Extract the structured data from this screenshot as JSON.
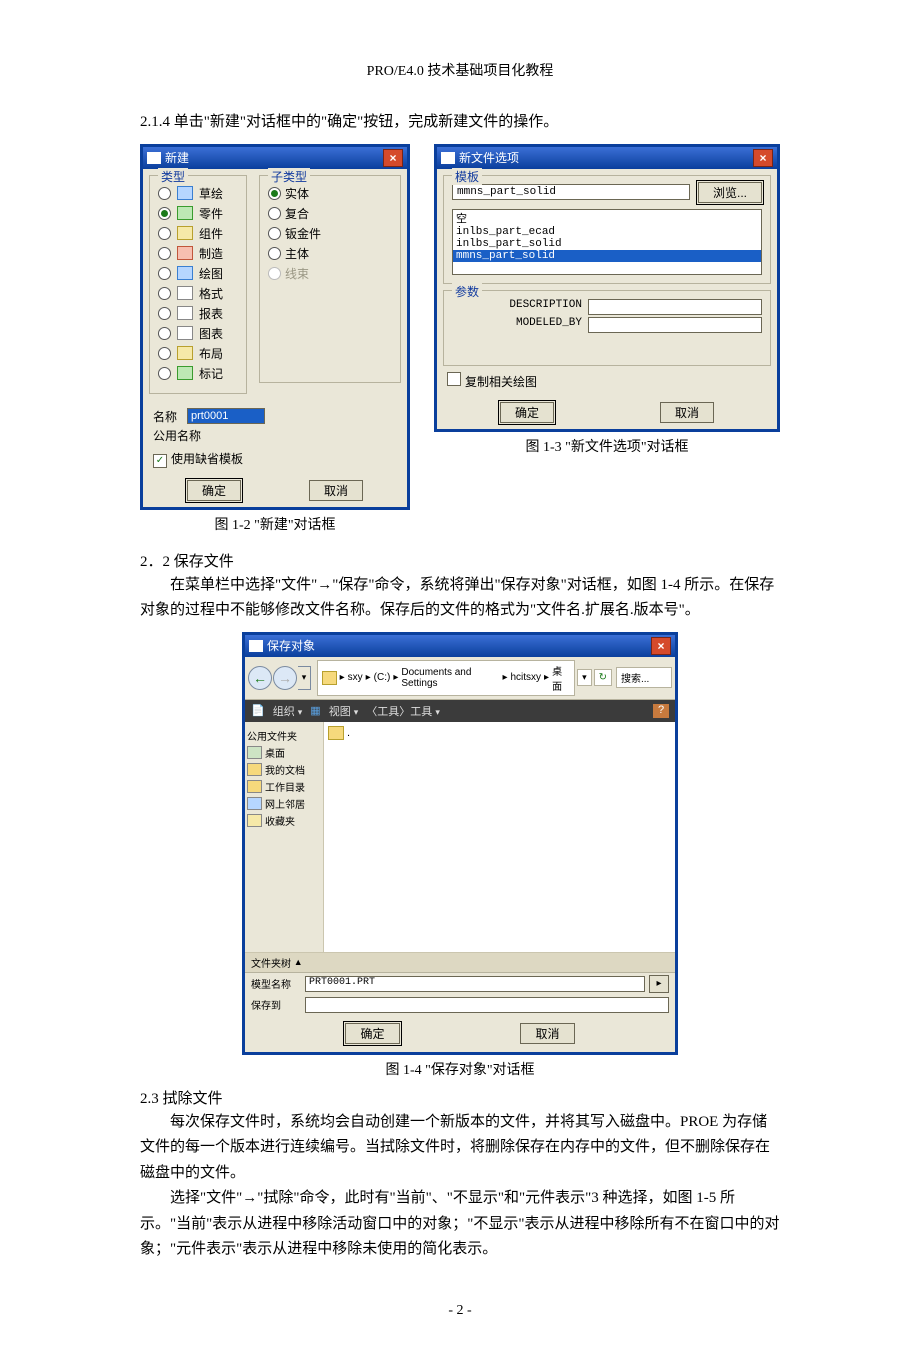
{
  "header": "PRO/E4.0 技术基础项目化教程",
  "text": {
    "step": "2.1.4 单击\"新建\"对话框中的\"确定\"按钮，完成新建文件的操作。",
    "cap12": "图 1-2  \"新建\"对话框",
    "cap13": "图 1-3  \"新文件选项\"对话框",
    "sec2": "2．2  保存文件",
    "p2a": "在菜单栏中选择\"文件\"→\"保存\"命令，系统将弹出\"保存对象\"对话框，如图 1-4 所示。在保存对象的过程中不能够修改文件名称。保存后的文件的格式为\"文件名.扩展名.版本号\"。",
    "cap14": "图 1-4  \"保存对象\"对话框",
    "sec3": "2.3  拭除文件",
    "p3a": "每次保存文件时，系统均会自动创建一个新版本的文件，并将其写入磁盘中。PROE 为存储文件的每一个版本进行连续编号。当拭除文件时，将删除保存在内存中的文件，但不删除保存在磁盘中的文件。",
    "p3b": "选择\"文件\"→\"拭除\"命令，此时有\"当前\"、\"不显示\"和\"元件表示\"3 种选择，如图 1-5 所示。\"当前\"表示从进程中移除活动窗口中的对象；\"不显示\"表示从进程中移除所有不在窗口中的对象；\"元件表示\"表示从进程中移除未使用的简化表示。"
  },
  "dlg_new": {
    "title": "新建",
    "group_type": "类型",
    "group_subtype": "子类型",
    "types": [
      "草绘",
      "零件",
      "组件",
      "制造",
      "绘图",
      "格式",
      "报表",
      "图表",
      "布局",
      "标记"
    ],
    "type_selected": 1,
    "subtypes": [
      "实体",
      "复合",
      "钣金件",
      "主体",
      "线束"
    ],
    "subtype_selected": 0,
    "name_label": "名称",
    "common_label": "公用名称",
    "name_value": "prt0001",
    "use_default": "使用缺省模板",
    "ok": "确定",
    "cancel": "取消"
  },
  "dlg_opt": {
    "title": "新文件选项",
    "group_tmpl": "模板",
    "tmpl_value": "mmns_part_solid",
    "browse": "浏览...",
    "list": [
      "空",
      "inlbs_part_ecad",
      "inlbs_part_solid",
      "mmns_part_solid"
    ],
    "list_selected": 3,
    "group_param": "参数",
    "param1": "DESCRIPTION",
    "param2": "MODELED_BY",
    "copy_draw": "复制相关绘图",
    "ok": "确定",
    "cancel": "取消"
  },
  "dlg_save": {
    "title": "保存对象",
    "crumbs": [
      "sxy",
      "(C:)",
      "Documents and Settings",
      "hcitsxy",
      "桌面"
    ],
    "search": "搜索...",
    "tb_org": "组织",
    "tb_view": "视图",
    "tb_tools": "〈工具〉工具",
    "side": [
      "公用文件夹",
      "桌面",
      "我的文档",
      "工作目录",
      "网上邻居",
      "收藏夹"
    ],
    "up": ".",
    "ft_header": "文件夹树",
    "model_label": "模型名称",
    "model_value": "PRT0001.PRT",
    "saveto_label": "保存到",
    "ok": "确定",
    "cancel": "取消"
  },
  "pagenum": "- 2 -"
}
